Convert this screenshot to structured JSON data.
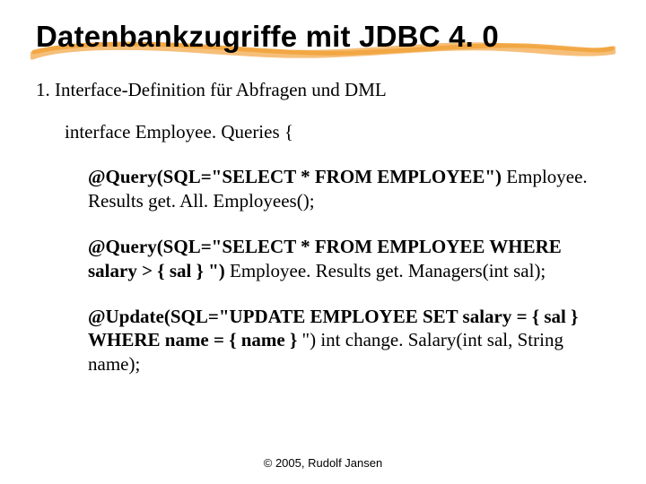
{
  "title": "Datenbankzugriffe mit JDBC 4. 0",
  "section": "1.  Interface-Definition für Abfragen und DML",
  "iface_open": "interface Employee. Queries {",
  "blocks": [
    {
      "bold": "@Query(SQL=\"SELECT * FROM EMPLOYEE\")",
      "rest": "Employee. Results get. All. Employees();"
    },
    {
      "bold": "@Query(SQL=\"SELECT * FROM EMPLOYEE WHERE salary > { sal } \")",
      "rest": " Employee. Results get. Managers(int sal);"
    },
    {
      "bold": "@Update(SQL=\"UPDATE EMPLOYEE SET salary = { sal } WHERE name = { name }",
      "rest": " \") int change. Salary(int sal, String name);"
    }
  ],
  "footer": "© 2005, Rudolf Jansen"
}
